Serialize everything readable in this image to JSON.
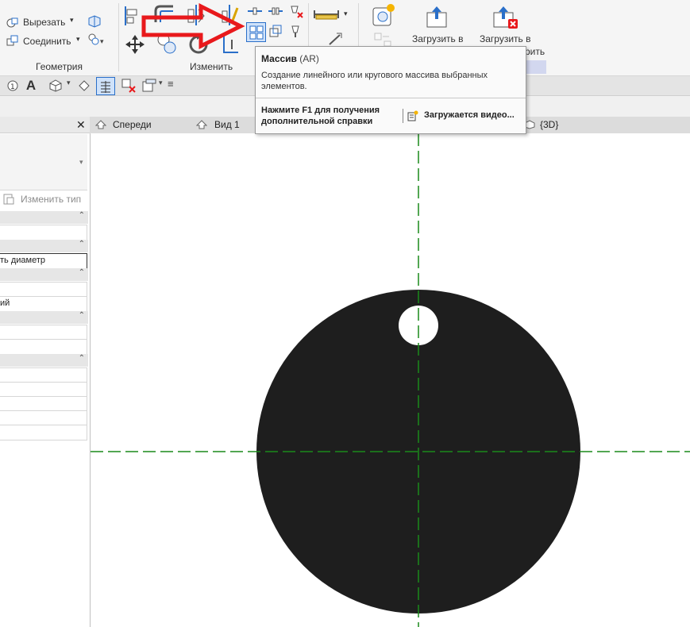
{
  "ribbon": {
    "cut_label": "Вырезать",
    "join_label": "Соединить",
    "geometry_panel_label": "Геометрия",
    "modify_panel_label": "Изменить",
    "load_in_1": "Загрузить в",
    "load_in_2": "Загрузить в",
    "load_in_2_suffix": "рить"
  },
  "tooltip": {
    "title": "Массив",
    "shortcut": "(AR)",
    "description": "Создание линейного или кругового массива выбранных элементов.",
    "help_text": "Нажмите F1 для получения дополнительной справки",
    "video_text": "Загружается видео..."
  },
  "view_tabs": [
    "Спереди",
    "Вид 1",
    "{3D}"
  ],
  "properties": {
    "edit_type_label": "Изменить тип",
    "row_diameter": "ть диаметр",
    "row_ij": "ий"
  },
  "colors": {
    "arrow_red": "#e8191c",
    "guide_green": "#1a8a1a",
    "shape_fill": "#1e1e1e",
    "selected_blue": "#2a6fc9"
  }
}
